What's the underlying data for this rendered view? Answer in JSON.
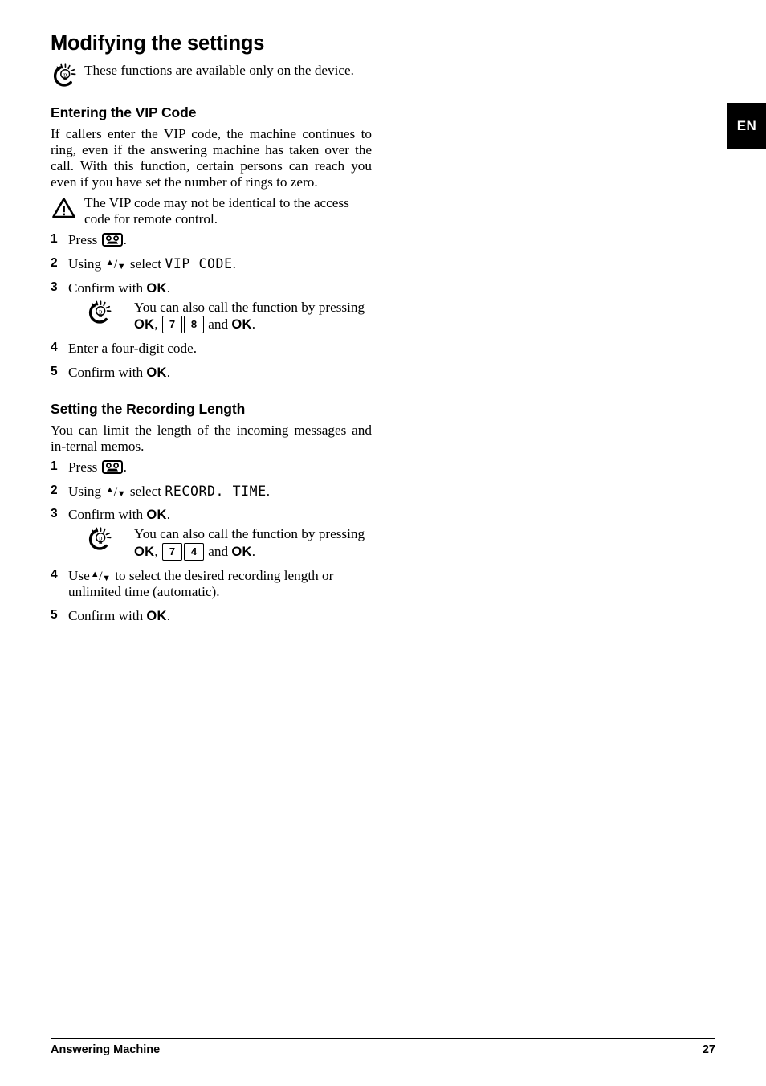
{
  "page": {
    "language_tab": "EN",
    "title": "Modifying the settings",
    "intro_note": "These functions are available only on the device."
  },
  "sections": [
    {
      "heading": "Entering the VIP Code",
      "body": "If callers enter the VIP code, the machine continues to ring, even if the answering machine has taken over the call. With this function, certain persons can reach you even if you have set the number of rings to zero.",
      "warning": "The VIP code may not be identical to the access code for remote control.",
      "steps": {
        "s1_num": "1",
        "s1_pre": "Press",
        "s1_post": ".",
        "s2_num": "2",
        "s2_pre": "Using",
        "s2_mid": "select",
        "s2_lcd": "VIP CODE",
        "s2_post": ".",
        "s3_num": "3",
        "s3_pre": "Confirm with",
        "s3_ok": "OK",
        "s3_post": ".",
        "s4_num": "4",
        "s4_text": "Enter a four-digit code.",
        "s5_num": "5",
        "s5_pre": "Confirm with",
        "s5_ok": "OK",
        "s5_post": "."
      },
      "tip": {
        "lead": "You can also call the function by pressing",
        "ok1": "OK",
        "comma": ",",
        "key1": "7",
        "key2": "8",
        "and": "and",
        "ok2": "OK",
        "end": "."
      }
    },
    {
      "heading": "Setting the Recording Length",
      "body": "You can limit the length of the incoming messages and in-ternal memos.",
      "steps": {
        "s1_num": "1",
        "s1_pre": "Press",
        "s1_post": ".",
        "s2_num": "2",
        "s2_pre": "Using",
        "s2_mid": "select",
        "s2_lcd": "RECORD. TIME",
        "s2_post": ".",
        "s3_num": "3",
        "s3_pre": "Confirm with",
        "s3_ok": "OK",
        "s3_post": ".",
        "s4_num": "4",
        "s4_pre": "Use",
        "s4_post": "to select the desired recording length or unlimited time (automatic).",
        "s5_num": "5",
        "s5_pre": "Confirm with",
        "s5_ok": "OK",
        "s5_post": "."
      },
      "tip": {
        "lead": "You can also call the function by pressing",
        "ok1": "OK",
        "comma": ",",
        "key1": "7",
        "key2": "4",
        "and": "and",
        "ok2": "OK",
        "end": "."
      }
    }
  ],
  "footer": {
    "left": "Answering Machine",
    "page_number": "27"
  },
  "icons": {
    "tip": "lightbulb-tip-icon",
    "warning": "warning-triangle-icon",
    "tape": "cassette-tape-button-icon",
    "arrow_up": "▲",
    "arrow_down": "▼",
    "slash": "/"
  },
  "colors": {
    "text": "#000000",
    "background": "#ffffff",
    "tab_background": "#000000",
    "tab_text": "#ffffff"
  }
}
